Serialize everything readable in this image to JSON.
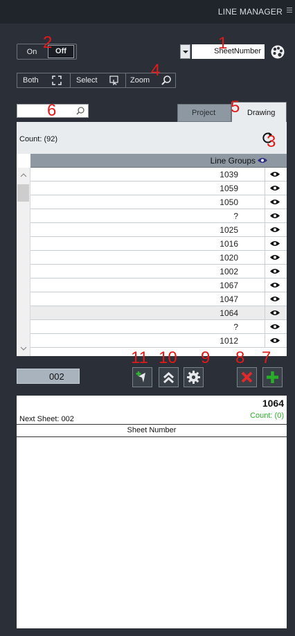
{
  "window": {
    "title": "LINE MANAGER"
  },
  "colors": {
    "accent_red": "#e21a1a",
    "accent_green": "#27b027",
    "panel_bg": "#2b3038",
    "header_bg": "#8e98a2"
  },
  "callouts": [
    "1",
    "2",
    "3",
    "4",
    "5",
    "6",
    "7",
    "8",
    "9",
    "10",
    "11"
  ],
  "toolbar": {
    "sheet_select_value": "SheetNumber",
    "toggle_off": "Off",
    "toggle_on": "On",
    "zoom_label": "Zoom",
    "select_label": "Select",
    "both_label": "Both"
  },
  "tabs": {
    "drawing": "Drawing",
    "project": "Project"
  },
  "search": {
    "value": ""
  },
  "list": {
    "count_label": "Count: (92)",
    "header": "Line Groups",
    "rows": [
      "1039",
      "1059",
      "1050",
      "?",
      "1025",
      "1016",
      "1020",
      "1002",
      "1067",
      "1047",
      "1064",
      "?",
      "1012"
    ],
    "selected_index": 10
  },
  "bottom": {
    "number_field": "002",
    "detail_title": "1064",
    "detail_count": "Count: (0)",
    "next_sheet": "Next Sheet: 002",
    "column_header": "Sheet Number"
  }
}
